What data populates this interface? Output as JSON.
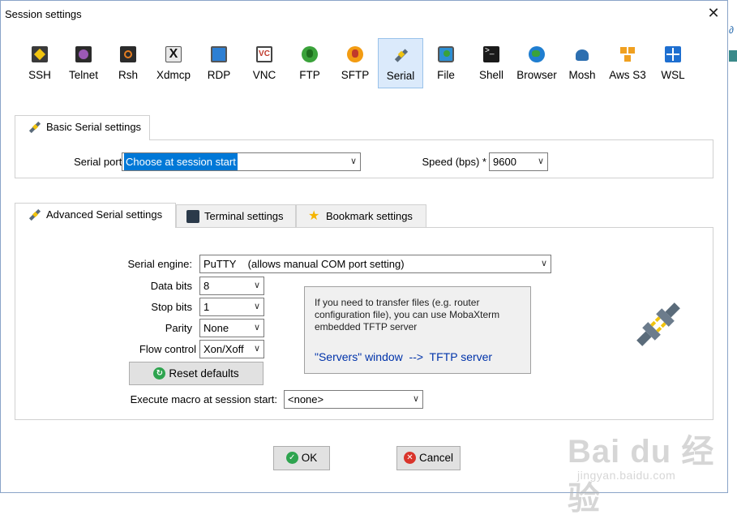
{
  "window": {
    "title": "Session settings"
  },
  "protocols": [
    {
      "label": "SSH",
      "icon": "ssh-icon",
      "color": "#3a3a3a"
    },
    {
      "label": "Telnet",
      "icon": "telnet-icon",
      "color": "#7a3fa8"
    },
    {
      "label": "Rsh",
      "icon": "rsh-icon",
      "color": "#b05a1a"
    },
    {
      "label": "Xdmcp",
      "icon": "xdmcp-icon",
      "color": "#444444"
    },
    {
      "label": "RDP",
      "icon": "rdp-icon",
      "color": "#2d7fd3"
    },
    {
      "label": "VNC",
      "icon": "vnc-icon",
      "color": "#c0392b"
    },
    {
      "label": "FTP",
      "icon": "ftp-icon",
      "color": "#3aa23a"
    },
    {
      "label": "SFTP",
      "icon": "sftp-icon",
      "color": "#e67e22"
    },
    {
      "label": "Serial",
      "icon": "serial-icon",
      "color": "#5a6b7a"
    },
    {
      "label": "File",
      "icon": "file-icon",
      "color": "#2d8fd3"
    },
    {
      "label": "Shell",
      "icon": "shell-icon",
      "color": "#1a1a1a"
    },
    {
      "label": "Browser",
      "icon": "browser-icon",
      "color": "#1f7ed0"
    },
    {
      "label": "Mosh",
      "icon": "mosh-icon",
      "color": "#2d6fb0"
    },
    {
      "label": "Aws S3",
      "icon": "aws-s3-icon",
      "color": "#f0a020"
    },
    {
      "label": "WSL",
      "icon": "wsl-icon",
      "color": "#1e6fd0"
    }
  ],
  "basic": {
    "tab_label": "Basic Serial settings",
    "serial_port_label": "Serial port *",
    "serial_port_value": "Choose at session start",
    "speed_label": "Speed (bps) *",
    "speed_value": "9600"
  },
  "tabs": {
    "advanced": "Advanced Serial settings",
    "terminal": "Terminal settings",
    "bookmark": "Bookmark settings"
  },
  "advanced": {
    "engine_label": "Serial engine:",
    "engine_value": "PuTTY    (allows manual COM port setting)",
    "data_bits_label": "Data bits",
    "data_bits_value": "8",
    "stop_bits_label": "Stop bits",
    "stop_bits_value": "1",
    "parity_label": "Parity",
    "parity_value": "None",
    "flow_label": "Flow control",
    "flow_value": "Xon/Xoff",
    "reset_label": "Reset defaults",
    "macro_label": "Execute macro at session start:",
    "macro_value": "<none>",
    "info_text": "If you need to transfer files (e.g. router configuration file), you can use MobaXterm embedded TFTP server",
    "info_link": "\"Servers\" window  -->  TFTP server"
  },
  "buttons": {
    "ok": "OK",
    "cancel": "Cancel"
  },
  "watermark": {
    "logo": "Bai du 经验",
    "sub": "jingyan.baidu.com"
  },
  "colors": {
    "selection": "#0078d7",
    "selected_tab_bg": "#dbeafb",
    "link": "#0033aa"
  }
}
